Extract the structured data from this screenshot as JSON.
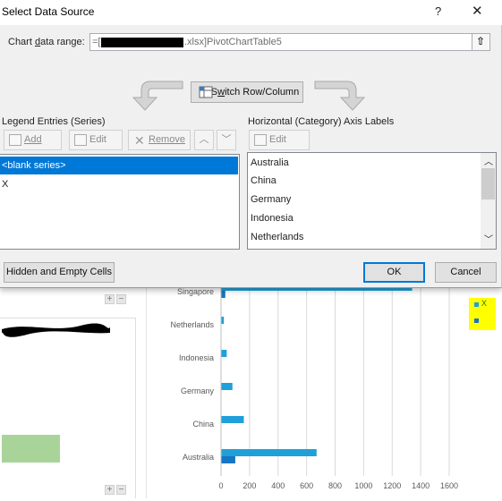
{
  "dialog": {
    "title": "Select Data Source",
    "help_label": "?",
    "close_label": "✕",
    "range_label_pre": "Chart ",
    "range_label_u": "d",
    "range_label_post": "ata range:",
    "range_prefix": "=[",
    "range_suffix": ".xlsx]PivotChartTable5",
    "collapse_label": "⇧",
    "switch_label_pre": "S",
    "switch_label_u": "w",
    "switch_label_post": "itch Row/Column",
    "legend_header": "Legend Entries (Series)",
    "legend_add": "Add",
    "legend_edit": "Edit",
    "legend_remove": "Remove",
    "legend_items": [
      "<blank series>",
      "X"
    ],
    "axis_header": "Horizontal (Category) Axis Labels",
    "axis_edit": "Edit",
    "axis_items": [
      "Australia",
      "China",
      "Germany",
      "Indonesia",
      "Netherlands"
    ],
    "hidden_cells": "Hidden and Empty Cells",
    "ok": "OK",
    "cancel": "Cancel"
  },
  "chart_data": {
    "type": "bar",
    "categories": [
      "Australia",
      "China",
      "Germany",
      "Indonesia",
      "Netherlands",
      "Singapore"
    ],
    "series": [
      {
        "values": [
          670,
          160,
          80,
          40,
          20,
          1340
        ]
      },
      {
        "values": [
          100,
          0,
          0,
          0,
          0,
          30
        ]
      }
    ],
    "xlim": [
      0,
      1600
    ],
    "xticks": [
      "0",
      "200",
      "400",
      "600",
      "800",
      "1000",
      "1200",
      "1400",
      "1600"
    ],
    "legend": [
      "",
      "X"
    ],
    "colors": [
      "#1fa0d8",
      "#1676c4"
    ]
  },
  "excel": {
    "plus": "+",
    "minus": "−"
  }
}
